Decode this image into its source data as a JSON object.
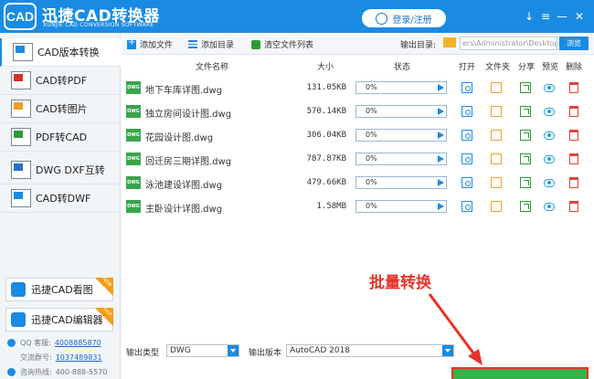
{
  "window": {
    "title": "迅捷CAD转换器",
    "subtitle": "XUNJIE CAD CONVERSION SOFTWARE",
    "logo_text": "CAD",
    "login_label": "登录/注册",
    "controls": [
      "↓",
      "≡",
      "—",
      "✕"
    ]
  },
  "sidebar": {
    "items": [
      {
        "label": "CAD版本转换",
        "icon": "version-convert-icon"
      },
      {
        "label": "CAD转PDF",
        "icon": "pdf-icon"
      },
      {
        "label": "CAD转图片",
        "icon": "image-icon"
      },
      {
        "label": "PDF转CAD",
        "icon": "cad-icon"
      },
      {
        "label": "DWG DXF互转",
        "icon": "dwg-dxf-icon"
      },
      {
        "label": "CAD转DWF",
        "icon": "dwf-icon"
      }
    ],
    "tools": [
      {
        "label": "迅捷CAD看图",
        "badge": "NEW"
      },
      {
        "label": "迅捷CAD编辑器",
        "badge": "HOT"
      }
    ],
    "contacts": [
      {
        "label": "QQ 客服:",
        "value": "4008885870"
      },
      {
        "label": "交流群号:",
        "value": "1037489831"
      },
      {
        "label": "咨询热线:",
        "value": "400-888-5570"
      }
    ]
  },
  "toolbar": {
    "add_file": "添加文件",
    "add_folder": "添加目录",
    "clear_list": "清空文件列表",
    "output_dir_label": "输出目录:",
    "output_dir_value": "ers\\Administrator\\Desktop",
    "browse": "浏览"
  },
  "table": {
    "headers": {
      "name": "文件名称",
      "size": "大小",
      "status": "状态",
      "open": "打开",
      "folder": "文件夹",
      "share": "分享",
      "preview": "预览",
      "delete": "删除"
    },
    "rows": [
      {
        "badge": "DWG",
        "name": "地下车库详图.dwg",
        "size": "131.05KB",
        "progress_text": "0%",
        "progress": 0
      },
      {
        "badge": "DWG",
        "name": "独立房间设计图.dwg",
        "size": "570.14KB",
        "progress_text": "0%",
        "progress": 0
      },
      {
        "badge": "DWG",
        "name": "花园设计图.dwg",
        "size": "306.04KB",
        "progress_text": "0%",
        "progress": 0
      },
      {
        "badge": "DWG",
        "name": "回迁房三期详图.dwg",
        "size": "787.87KB",
        "progress_text": "0%",
        "progress": 0
      },
      {
        "badge": "DWG",
        "name": "泳池建设详图.dwg",
        "size": "479.66KB",
        "progress_text": "0%",
        "progress": 0
      },
      {
        "badge": "DWG",
        "name": "主卧设计详图.dwg",
        "size": "1.58MB",
        "progress_text": "0%",
        "progress": 0
      }
    ]
  },
  "bottom": {
    "output_type_label": "输出类型",
    "output_type_value": "DWG",
    "output_version_label": "输出版本",
    "output_version_value": "AutoCAD 2018"
  },
  "annotation": {
    "text": "批量转换",
    "color": "#e8322b"
  },
  "colors": {
    "accent": "#1a8be3",
    "convert": "#34b34a"
  }
}
